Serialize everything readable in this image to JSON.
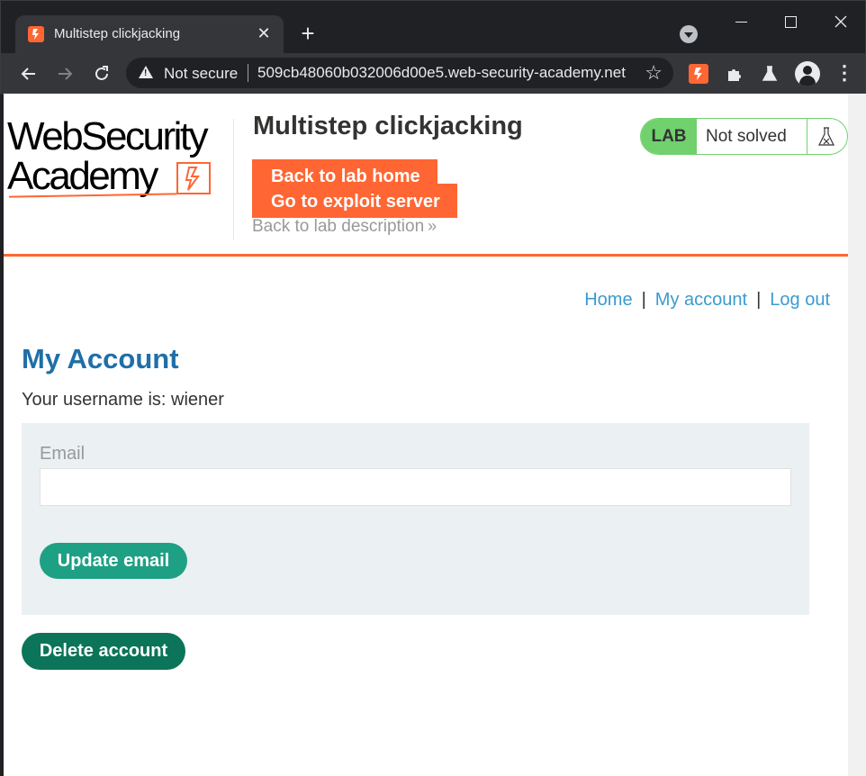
{
  "browser": {
    "tab_title": "Multistep clickjacking",
    "tab_close": "✕",
    "new_tab": "+",
    "security_label": "Not secure",
    "url": "509cb48060b032006d00e5.web-security-academy.net"
  },
  "icons": {
    "back": "arrow-left-icon",
    "forward": "arrow-right-icon",
    "reload": "reload-icon",
    "warning": "warning-icon",
    "star": "star-icon",
    "burp": "burp-extension-icon",
    "extensions": "puzzle-icon",
    "labs": "flask-icon",
    "profile": "profile-icon",
    "menu": "kebab-menu-icon"
  },
  "header": {
    "logo_line1": "WebSecurity",
    "logo_line2": "Academy",
    "lab_title": "Multistep clickjacking",
    "back_to_lab_home": "Back to lab home",
    "go_to_exploit_server": "Go to exploit server",
    "back_to_lab_description": "Back to lab description",
    "status_tag": "LAB",
    "status_text": "Not solved"
  },
  "nav": {
    "home": "Home",
    "sep": "|",
    "my_account": "My account",
    "log_out": "Log out"
  },
  "main": {
    "heading": "My Account",
    "username_line": "Your username is: wiener",
    "email_label": "Email",
    "email_value": "",
    "update_email": "Update email",
    "delete_account": "Delete account"
  },
  "colors": {
    "accent": "#ff6633",
    "status_green": "#70d16d",
    "link_blue": "#3a9bd0",
    "heading_blue": "#1f6fa8",
    "update_button": "#1ea084",
    "delete_button": "#0c7458"
  }
}
